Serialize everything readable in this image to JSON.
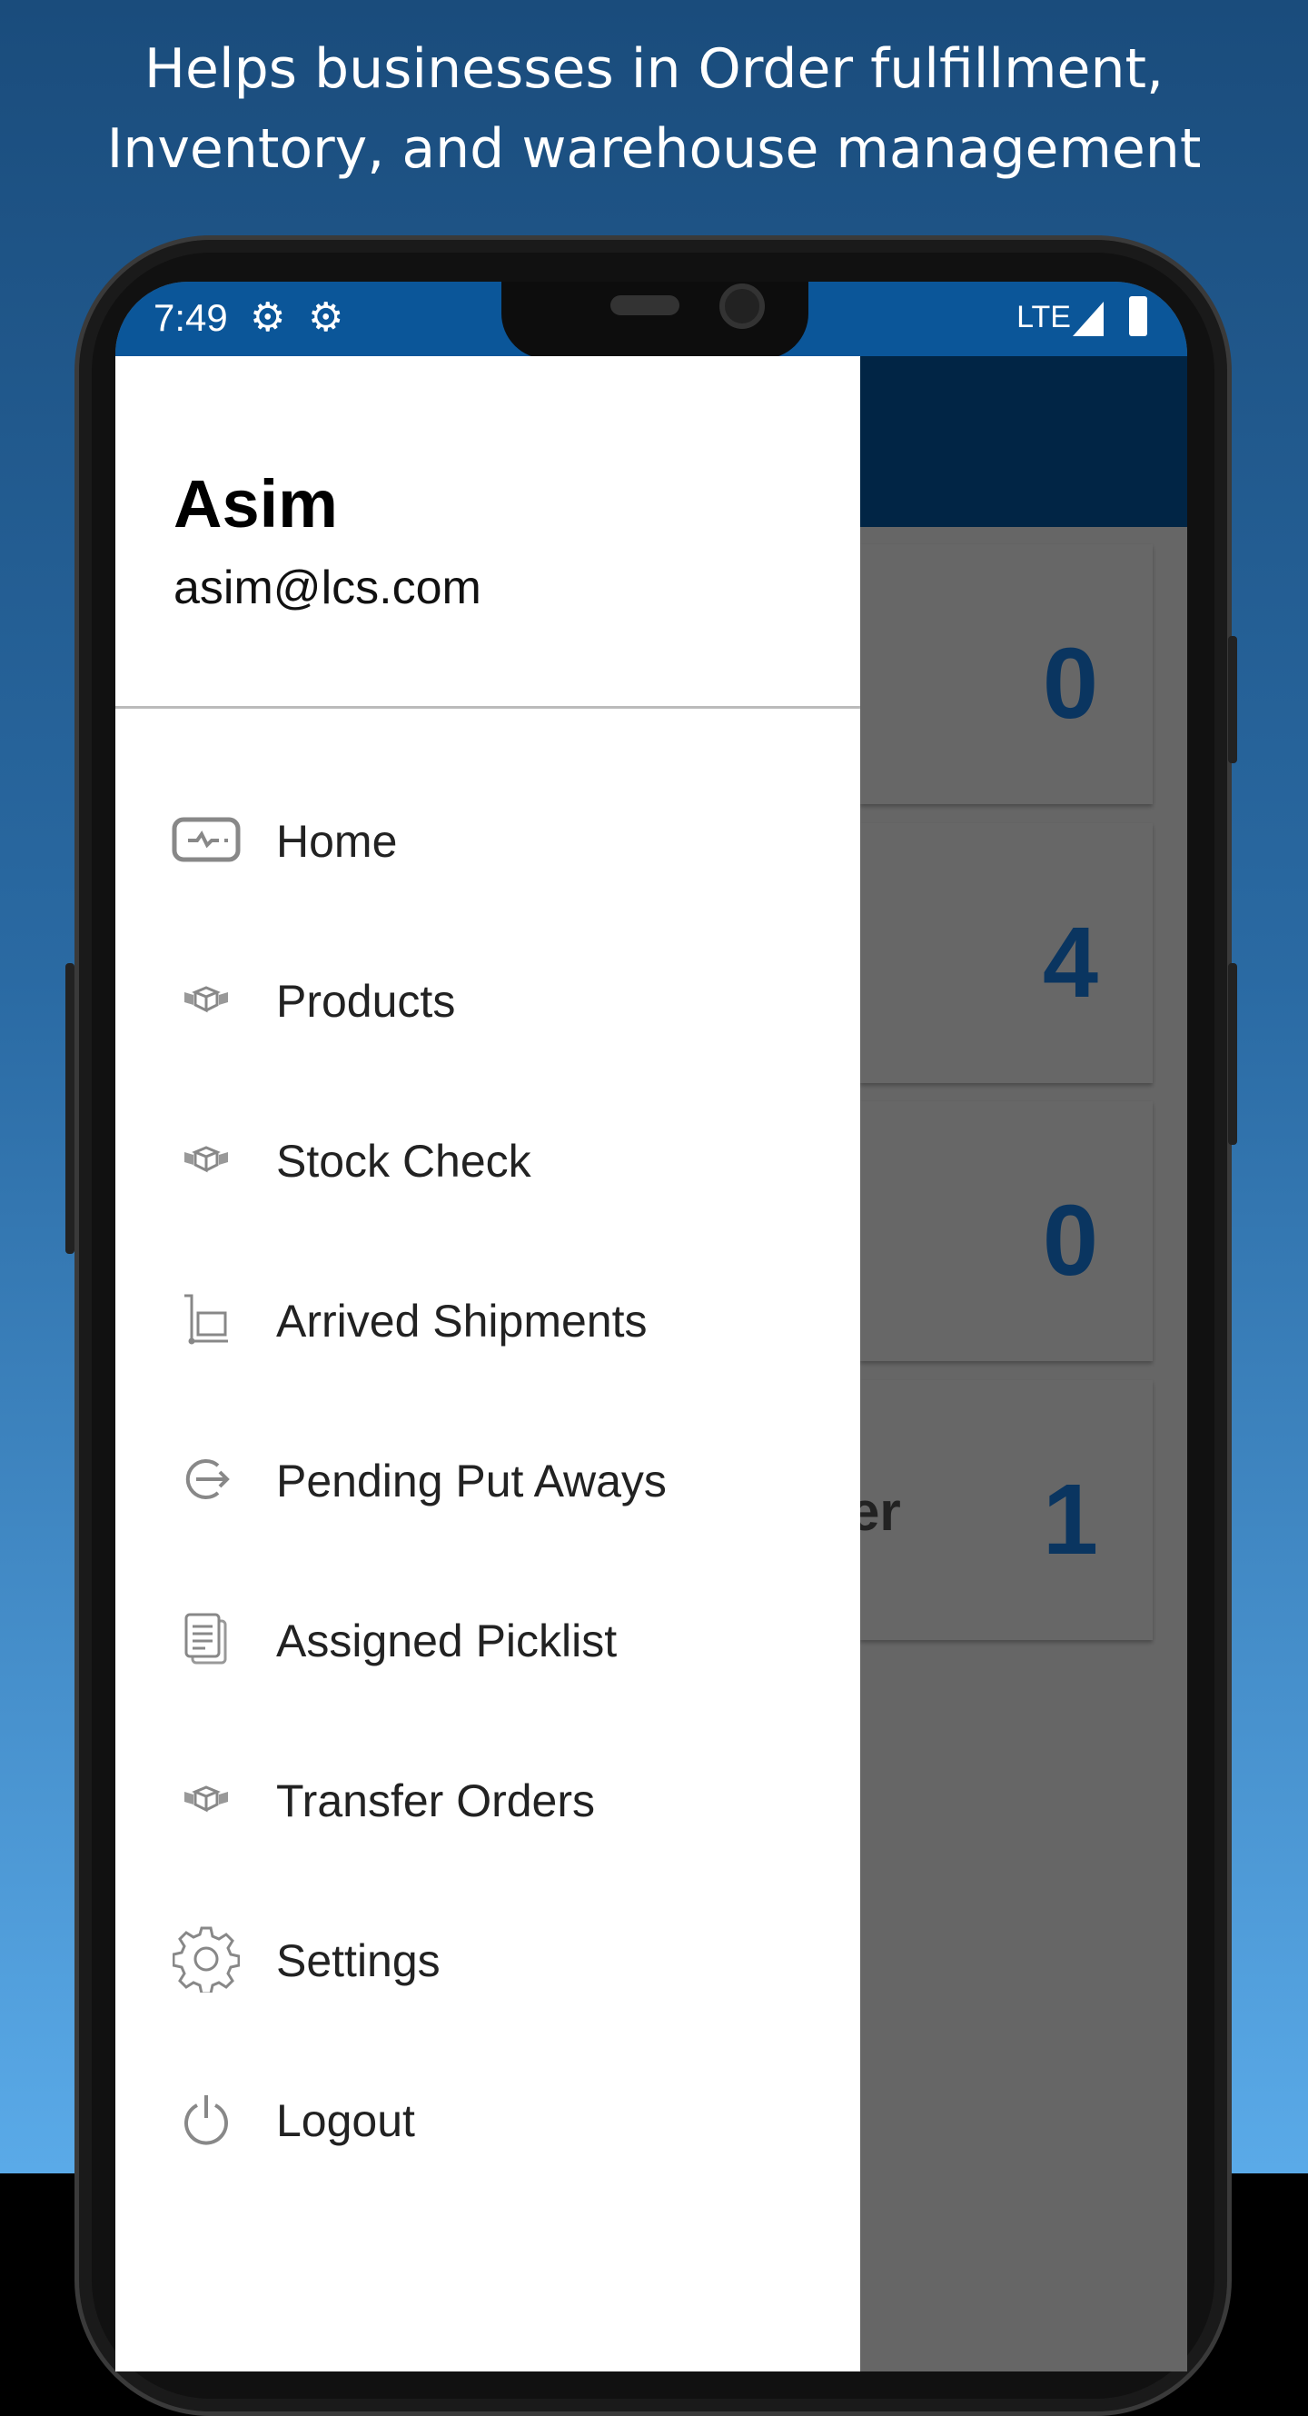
{
  "headline": [
    "Helps businesses in Order fulfillment,",
    "Inventory, and warehouse management"
  ],
  "status_bar": {
    "time": "7:49",
    "network": "LTE",
    "color": "#0b5699"
  },
  "user": {
    "name": "Asim",
    "email": "asim@lcs.com"
  },
  "menu": [
    {
      "label": "Home",
      "icon": "dashboard-icon"
    },
    {
      "label": "Products",
      "icon": "boxes-icon"
    },
    {
      "label": "Stock Check",
      "icon": "boxes-icon"
    },
    {
      "label": "Arrived Shipments",
      "icon": "hand-truck-icon"
    },
    {
      "label": "Pending Put Aways",
      "icon": "put-away-arrow-icon"
    },
    {
      "label": "Assigned Picklist",
      "icon": "documents-icon"
    },
    {
      "label": "Transfer Orders",
      "icon": "boxes-icon"
    },
    {
      "label": "Settings",
      "icon": "gear-icon"
    },
    {
      "label": "Logout",
      "icon": "power-icon"
    }
  ],
  "cards": [
    {
      "value": "0"
    },
    {
      "value": "4"
    },
    {
      "value": "0"
    },
    {
      "value": "1",
      "label_fragment": "er"
    }
  ],
  "colors": {
    "appbar": "#012545",
    "count": "#0a3560"
  }
}
